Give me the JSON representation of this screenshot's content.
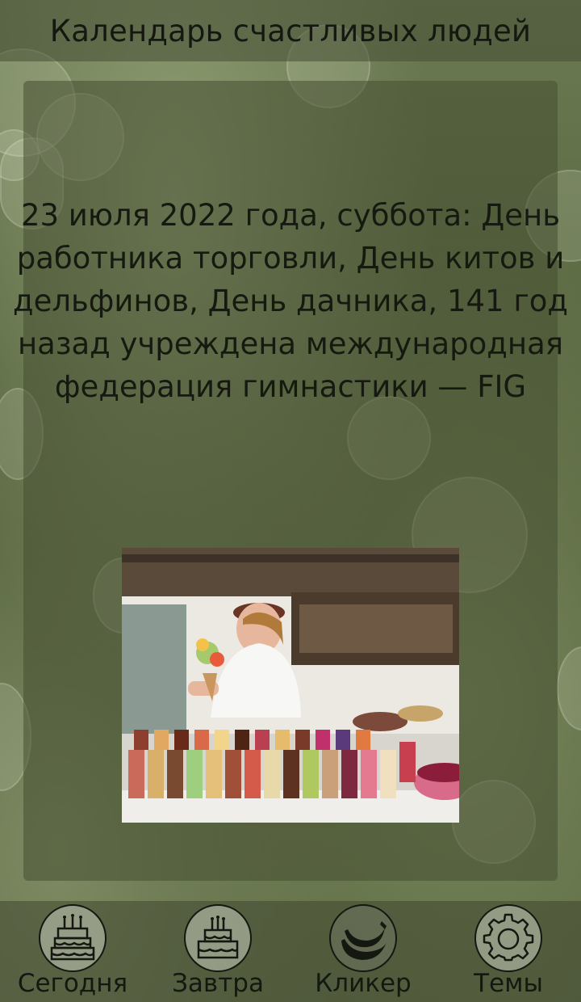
{
  "app": {
    "title": "Календарь счастливых людей"
  },
  "content": {
    "text": "23 июля 2022 года, суббота: День работника торговли, День китов и дельфинов, День дачника, 141 год назад учреждена международная федерация гимнастики — FIG"
  },
  "nav": {
    "items": [
      {
        "label": "Сегодня",
        "icon": "birthday-cake-icon"
      },
      {
        "label": "Завтра",
        "icon": "birthday-cake-icon"
      },
      {
        "label": "Кликер",
        "icon": "banana-icon"
      },
      {
        "label": "Темы",
        "icon": "gear-icon"
      }
    ]
  },
  "colors": {
    "background": "#5d6a45",
    "text": "#141810",
    "card": "#464e32"
  }
}
